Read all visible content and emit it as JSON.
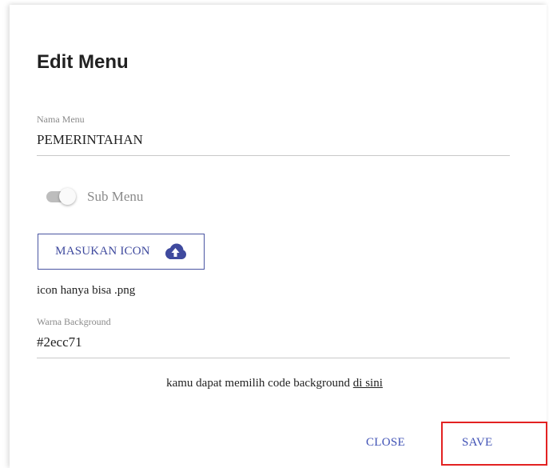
{
  "dialog": {
    "title": "Edit Menu",
    "nama_menu": {
      "label": "Nama Menu",
      "value": "PEMERINTAHAN"
    },
    "sub_menu": {
      "label": "Sub Menu",
      "checked": true
    },
    "upload": {
      "label": "MASUKAN ICON",
      "icon": "cloud-upload-icon"
    },
    "icon_hint": "icon hanya bisa .png",
    "warna_background": {
      "label": "Warna Background",
      "value": "#2ecc71"
    },
    "help": {
      "text": "kamu dapat memilih code background ",
      "link": "di sini"
    },
    "actions": {
      "close": "CLOSE",
      "save": "SAVE"
    }
  },
  "colors": {
    "accent": "#3f51b5",
    "upload_border": "#4a55a2",
    "highlight": "#e32222",
    "switch_track": "#bdbdbd"
  }
}
